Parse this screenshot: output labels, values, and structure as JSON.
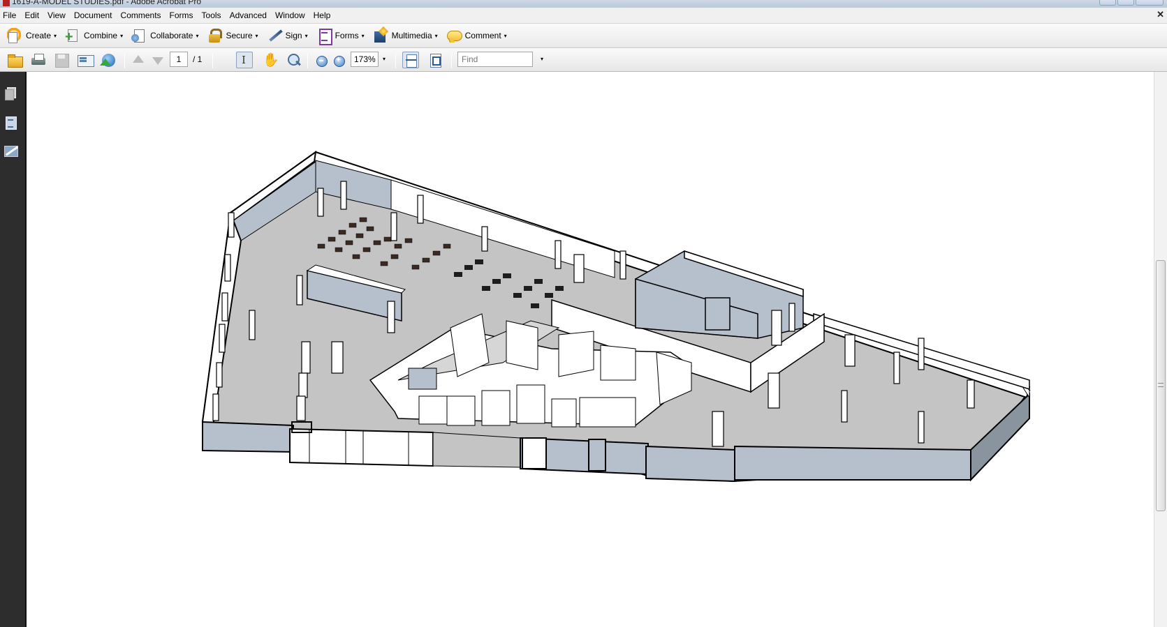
{
  "window": {
    "title": "1619-A-MODEL STUDIES.pdf - Adobe Acrobat Pro",
    "close_glyph": "✕"
  },
  "menubar": {
    "items": [
      "File",
      "Edit",
      "View",
      "Document",
      "Comments",
      "Forms",
      "Tools",
      "Advanced",
      "Window",
      "Help"
    ]
  },
  "task_toolbar": {
    "create": "Create",
    "combine": "Combine",
    "collaborate": "Collaborate",
    "secure": "Secure",
    "sign": "Sign",
    "forms": "Forms",
    "multimedia": "Multimedia",
    "comment": "Comment",
    "dropdown_glyph": "▾"
  },
  "nav_toolbar": {
    "current_page": "1",
    "page_total": "/ 1",
    "zoom": "173%",
    "find_placeholder": "Find",
    "dropdown_glyph": "▾"
  },
  "left_pane": {
    "icons": [
      "pages-icon",
      "bookmarks-icon",
      "signatures-icon"
    ]
  },
  "document": {
    "content": "isometric 3D floor plan model",
    "colors": {
      "floor": "#c4c4c4",
      "wall_face": "#b5c0cc",
      "wall_top": "#ffffff",
      "outline": "#000000"
    }
  },
  "colors": {
    "chrome_bg": "#f0f0f0",
    "left_pane_bg": "#2d2d2d",
    "doc_bg": "#ffffff"
  }
}
